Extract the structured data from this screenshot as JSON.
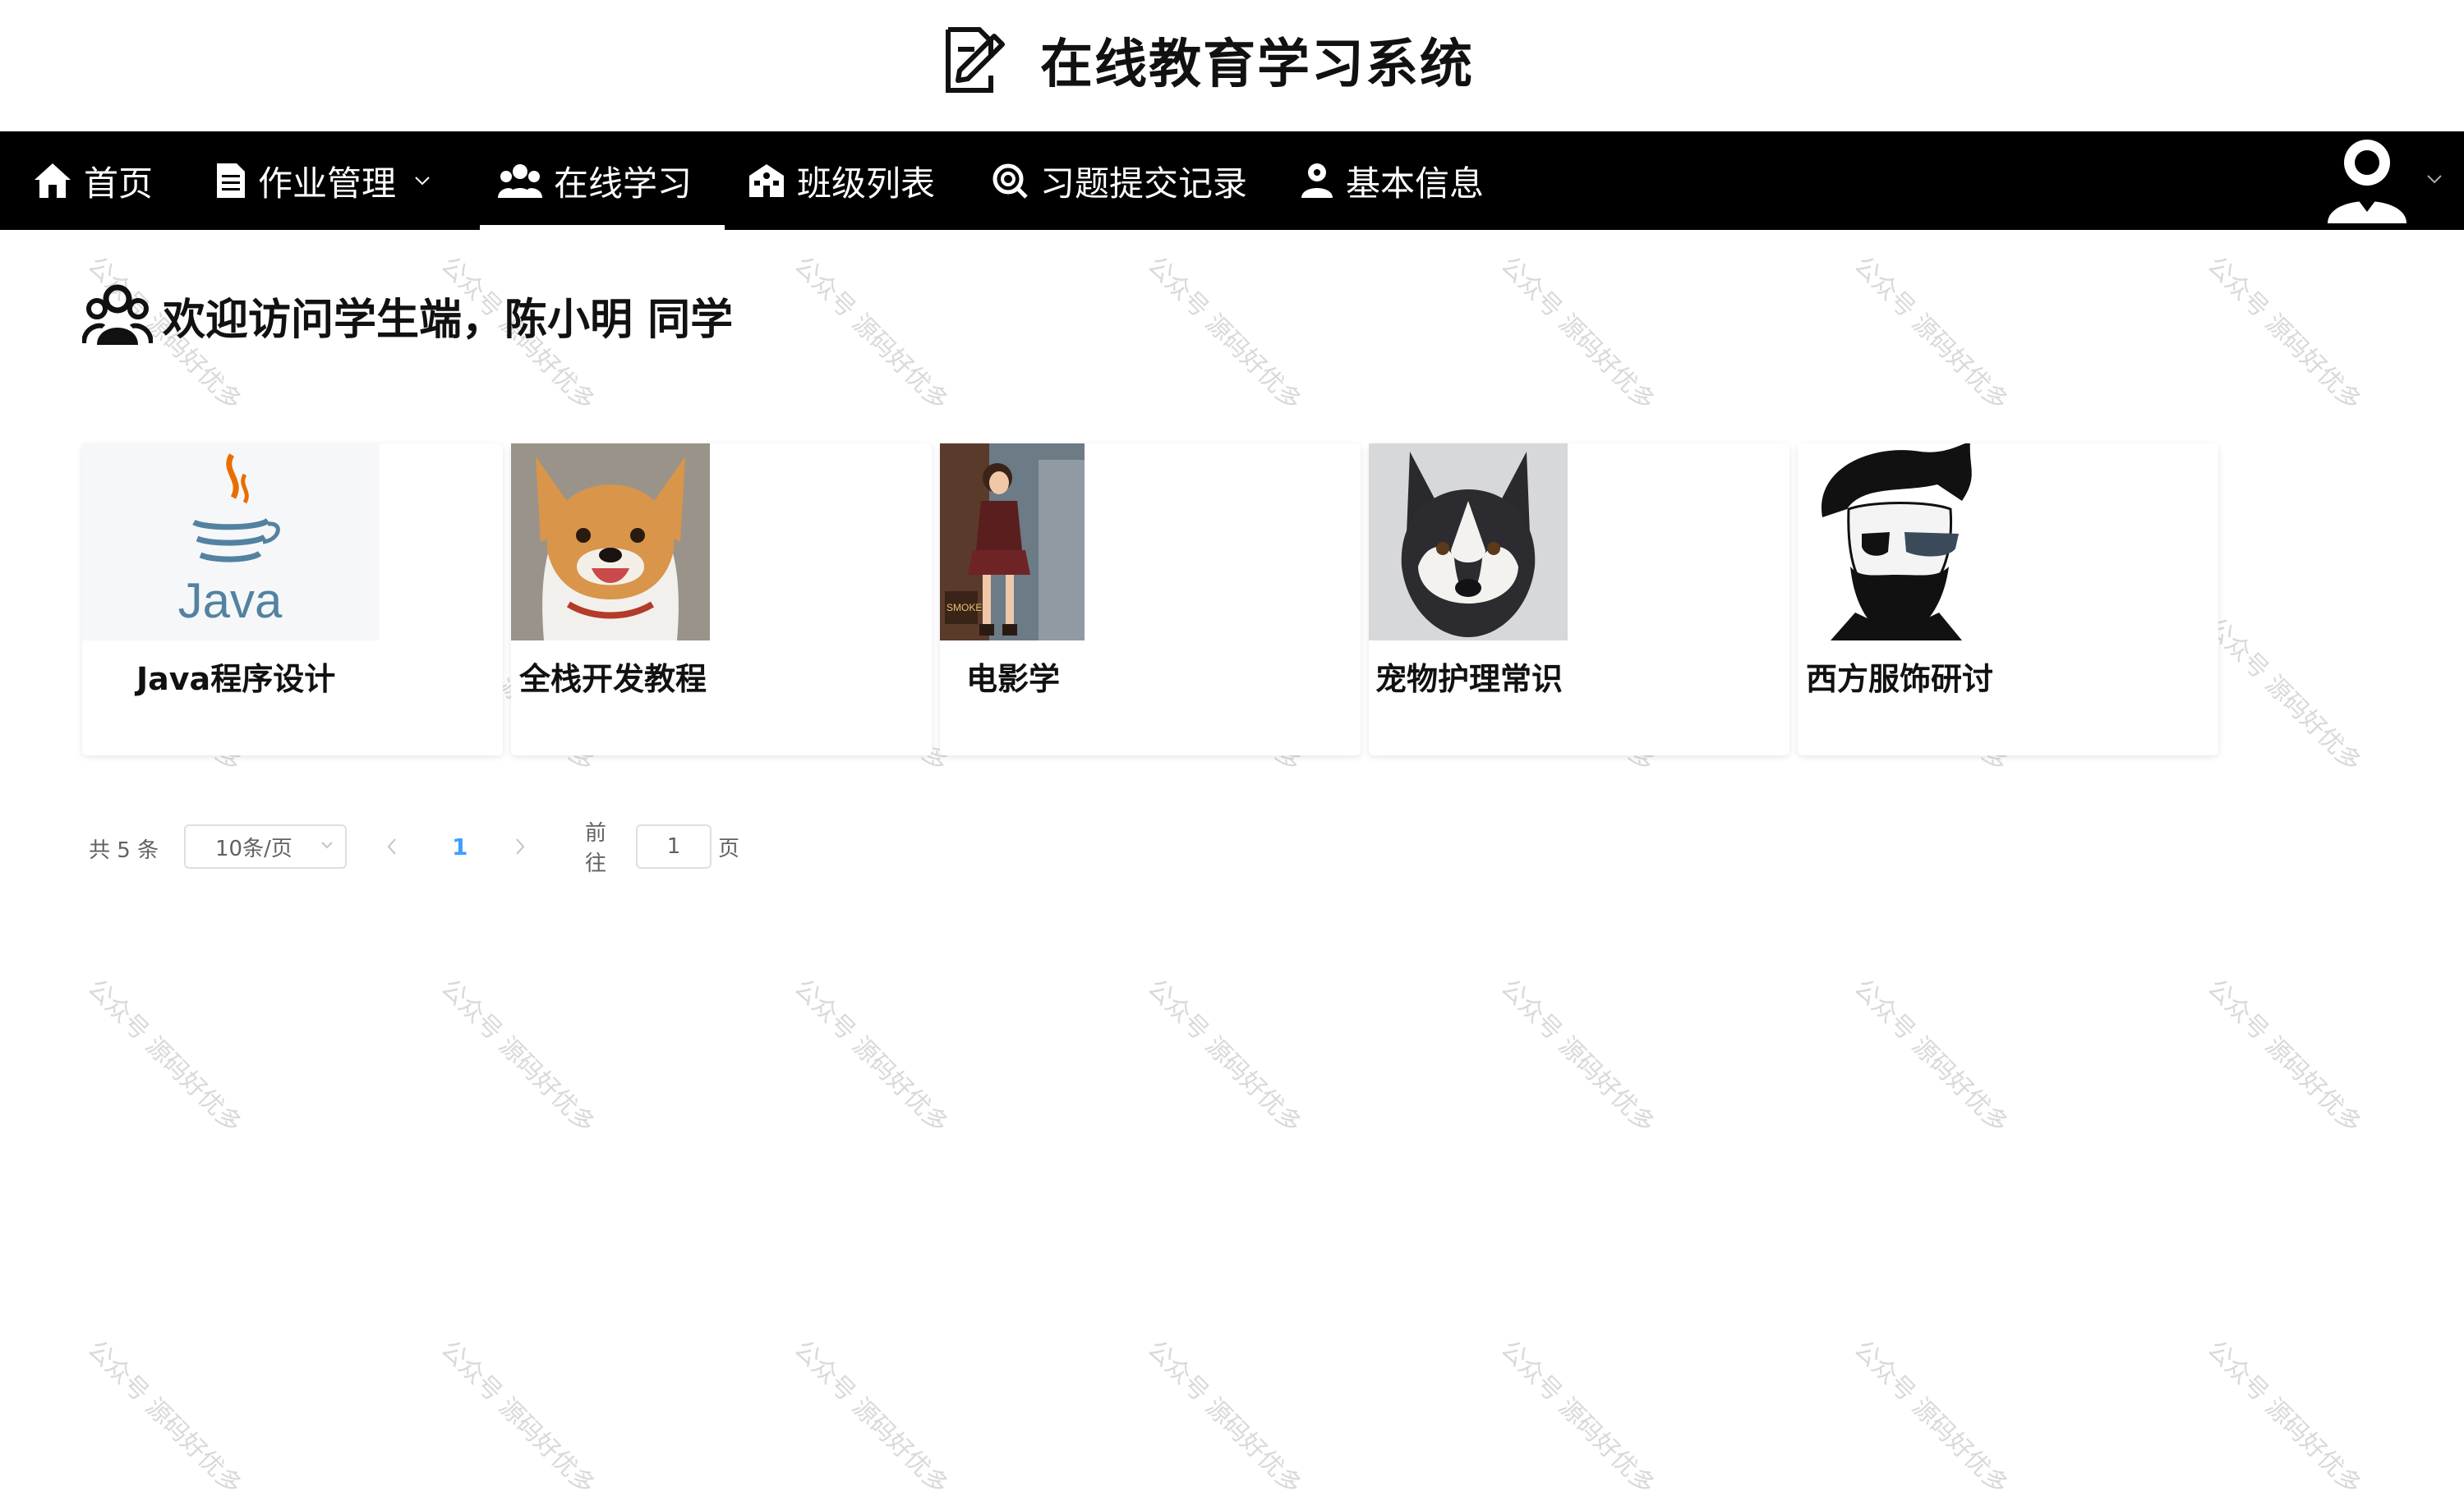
{
  "header": {
    "title": "在线教育学习系统",
    "logo_icon": "edit-document-icon"
  },
  "nav": {
    "items": [
      {
        "label": "首页",
        "icon": "home-icon"
      },
      {
        "label": "作业管理",
        "icon": "document-icon",
        "has_dropdown": true
      },
      {
        "label": "在线学习",
        "icon": "group-icon",
        "active": true
      },
      {
        "label": "班级列表",
        "icon": "school-icon"
      },
      {
        "label": "习题提交记录",
        "icon": "search-record-icon"
      },
      {
        "label": "基本信息",
        "icon": "user-info-icon"
      }
    ],
    "user_icon": "user-avatar-icon"
  },
  "welcome": {
    "text": "欢迎访问学生端，陈小明 同学",
    "icon": "users-icon"
  },
  "courses": [
    {
      "title": "Java程序设计",
      "image": "java-logo"
    },
    {
      "title": "全栈开发教程",
      "image": "shiba-dog-photo"
    },
    {
      "title": "电影学",
      "image": "anime-girl-poster"
    },
    {
      "title": "宠物护理常识",
      "image": "husky-dog-photo"
    },
    {
      "title": "西方服饰研讨",
      "image": "bearded-man-sunglasses-drawing"
    }
  ],
  "pagination": {
    "total": "共 5 条",
    "page_size": "10条/页",
    "current_page": "1",
    "goto_prefix": "前往",
    "goto_value": "1",
    "goto_suffix": "页"
  },
  "watermark": {
    "text": "公众号 源码好优多"
  },
  "colors": {
    "nav_bg": "#000000",
    "accent": "#409eff"
  }
}
